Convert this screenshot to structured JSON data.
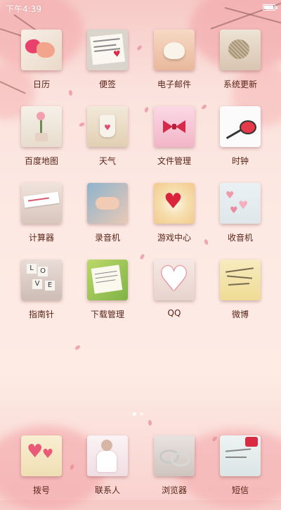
{
  "status_bar": {
    "time": "下午4:39",
    "icons": [
      "battery-icon"
    ]
  },
  "apps": [
    {
      "label": "日历",
      "icon": "calendar-icon"
    },
    {
      "label": "便签",
      "icon": "notes-icon"
    },
    {
      "label": "电子邮件",
      "icon": "email-icon"
    },
    {
      "label": "系统更新",
      "icon": "system-update-icon"
    },
    {
      "label": "百度地图",
      "icon": "baidu-map-icon"
    },
    {
      "label": "天气",
      "icon": "weather-icon"
    },
    {
      "label": "文件管理",
      "icon": "file-manager-icon"
    },
    {
      "label": "时钟",
      "icon": "clock-icon"
    },
    {
      "label": "计算器",
      "icon": "calculator-icon"
    },
    {
      "label": "录音机",
      "icon": "recorder-icon"
    },
    {
      "label": "游戏中心",
      "icon": "game-center-icon"
    },
    {
      "label": "收音机",
      "icon": "radio-icon"
    },
    {
      "label": "指南针",
      "icon": "compass-icon"
    },
    {
      "label": "下载管理",
      "icon": "download-manager-icon"
    },
    {
      "label": "QQ",
      "icon": "qq-icon"
    },
    {
      "label": "微博",
      "icon": "weibo-icon"
    }
  ],
  "dock": [
    {
      "label": "拨号",
      "icon": "phone-icon"
    },
    {
      "label": "联系人",
      "icon": "contacts-icon"
    },
    {
      "label": "浏览器",
      "icon": "browser-icon"
    },
    {
      "label": "短信",
      "icon": "messages-icon"
    }
  ],
  "page_indicator": {
    "pages": 2,
    "current": 1
  },
  "colors": {
    "label": "#5a2418",
    "accent": "#e85a70"
  }
}
